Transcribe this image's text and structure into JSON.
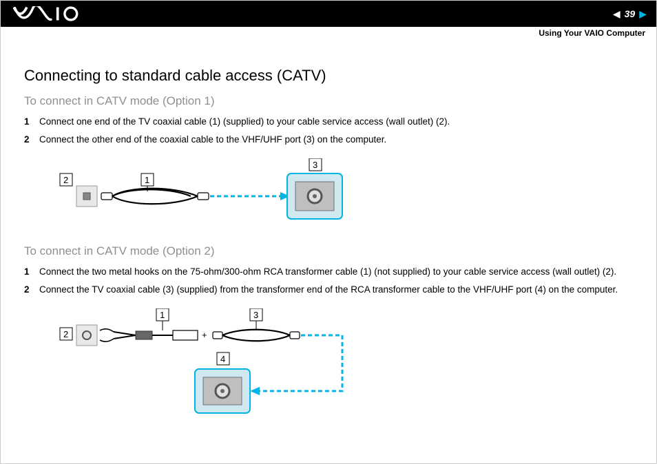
{
  "header": {
    "page_number": "39",
    "section_title": "Using Your VAIO Computer"
  },
  "main": {
    "title": "Connecting to standard cable access (CATV)",
    "option1": {
      "heading": "To connect in CATV mode (Option 1)",
      "steps": [
        "Connect one end of the TV coaxial cable (1) (supplied) to your cable service access (wall outlet) (2).",
        "Connect the other end of the coaxial cable to the VHF/UHF port (3) on the computer."
      ]
    },
    "option2": {
      "heading": "To connect in CATV mode (Option 2)",
      "steps": [
        "Connect the two metal hooks on the 75-ohm/300-ohm RCA transformer cable (1) (not supplied) to your cable service access (wall outlet) (2).",
        "Connect the TV coaxial cable (3) (supplied) from the transformer end of the RCA transformer cable to the VHF/UHF port (4) on the computer."
      ]
    }
  },
  "callouts": {
    "c1": "1",
    "c2": "2",
    "c3": "3",
    "c4": "4"
  }
}
